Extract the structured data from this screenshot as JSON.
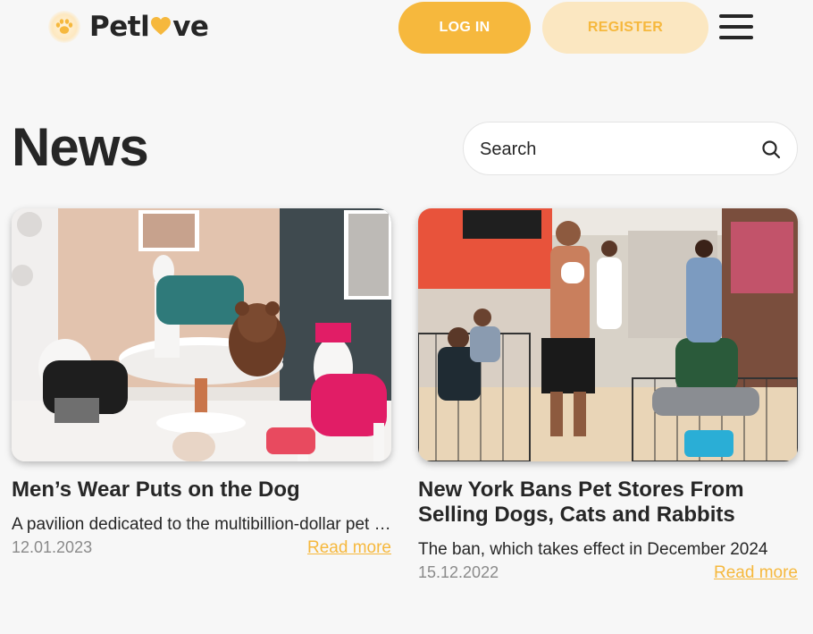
{
  "brand": {
    "name_before": "Petl",
    "name_after": "ve",
    "accent_color": "#f6b83d",
    "logo_icon": "paw-icon",
    "heart_icon": "heart-icon"
  },
  "header": {
    "login_label": "LOG IN",
    "register_label": "REGISTER",
    "menu_icon": "hamburger-menu-icon"
  },
  "page": {
    "title": "News"
  },
  "search": {
    "placeholder": "Search",
    "icon": "search-icon"
  },
  "news": [
    {
      "title": "Men’s Wear Puts on the Dog",
      "text": "A pavilion dedicated to the multibillion-dollar pet industry",
      "date": "12.01.2023",
      "link": "Read more"
    },
    {
      "title": "New York Bans Pet Stores From Selling Dogs, Cats and Rabbits",
      "text": "The ban, which takes effect in December 2024",
      "date": "15.12.2022",
      "link": "Read more"
    }
  ]
}
